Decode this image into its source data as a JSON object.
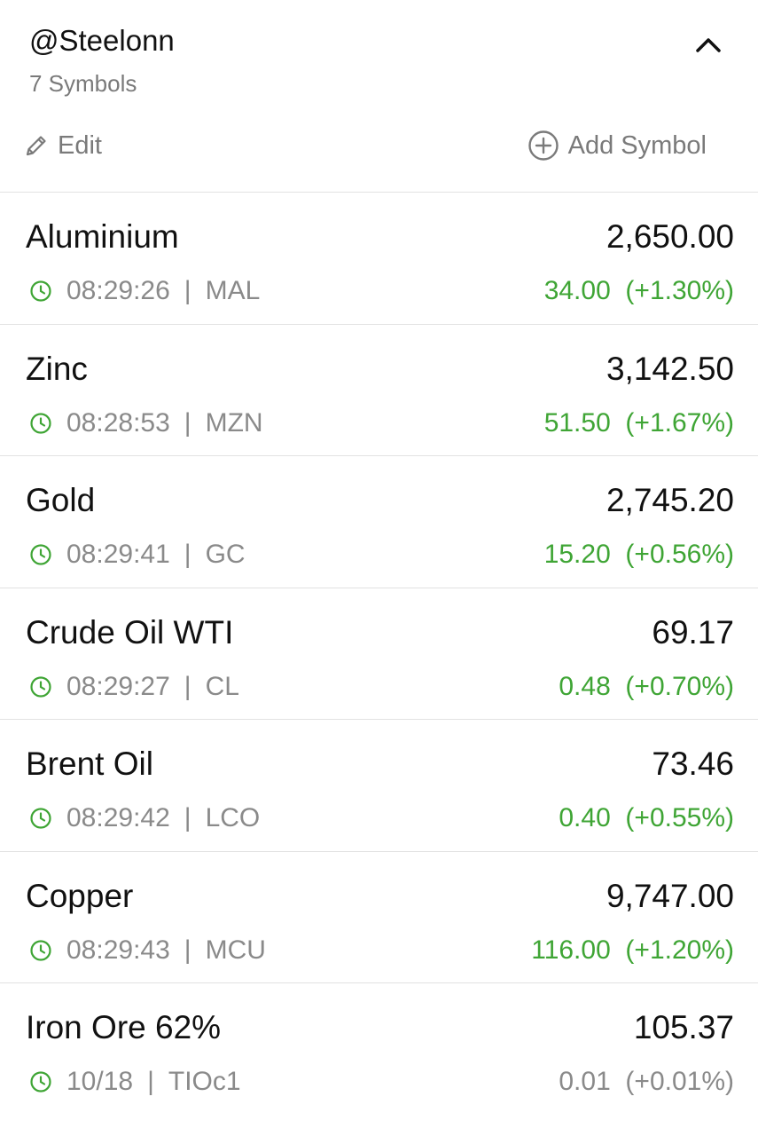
{
  "colors": {
    "positive": "#3fa535",
    "neutral": "#8a8a8a",
    "clock": "#3fa535"
  },
  "header": {
    "title": "@Steelonn",
    "symbol_count": "7 Symbols",
    "edit_label": "Edit",
    "add_label": "Add Symbol",
    "collapse_icon": "chevron-up-icon",
    "edit_icon": "pencil-icon",
    "add_icon": "plus-circle-icon"
  },
  "rows": [
    {
      "name": "Aluminium",
      "price": "2,650.00",
      "time": "08:29:26",
      "ticker": "MAL",
      "change": "34.00  (+1.30%)",
      "status": "positive"
    },
    {
      "name": "Zinc",
      "price": "3,142.50",
      "time": "08:28:53",
      "ticker": "MZN",
      "change": "51.50  (+1.67%)",
      "status": "positive"
    },
    {
      "name": "Gold",
      "price": "2,745.20",
      "time": "08:29:41",
      "ticker": "GC",
      "change": "15.20  (+0.56%)",
      "status": "positive"
    },
    {
      "name": "Crude Oil WTI",
      "price": "69.17",
      "time": "08:29:27",
      "ticker": "CL",
      "change": "0.48  (+0.70%)",
      "status": "positive"
    },
    {
      "name": "Brent Oil",
      "price": "73.46",
      "time": "08:29:42",
      "ticker": "LCO",
      "change": "0.40  (+0.55%)",
      "status": "positive"
    },
    {
      "name": "Copper",
      "price": "9,747.00",
      "time": "08:29:43",
      "ticker": "MCU",
      "change": "116.00  (+1.20%)",
      "status": "positive"
    },
    {
      "name": "Iron Ore 62%",
      "price": "105.37",
      "time": "10/18",
      "ticker": "TIOc1",
      "change": "0.01  (+0.01%)",
      "status": "neutral"
    }
  ]
}
